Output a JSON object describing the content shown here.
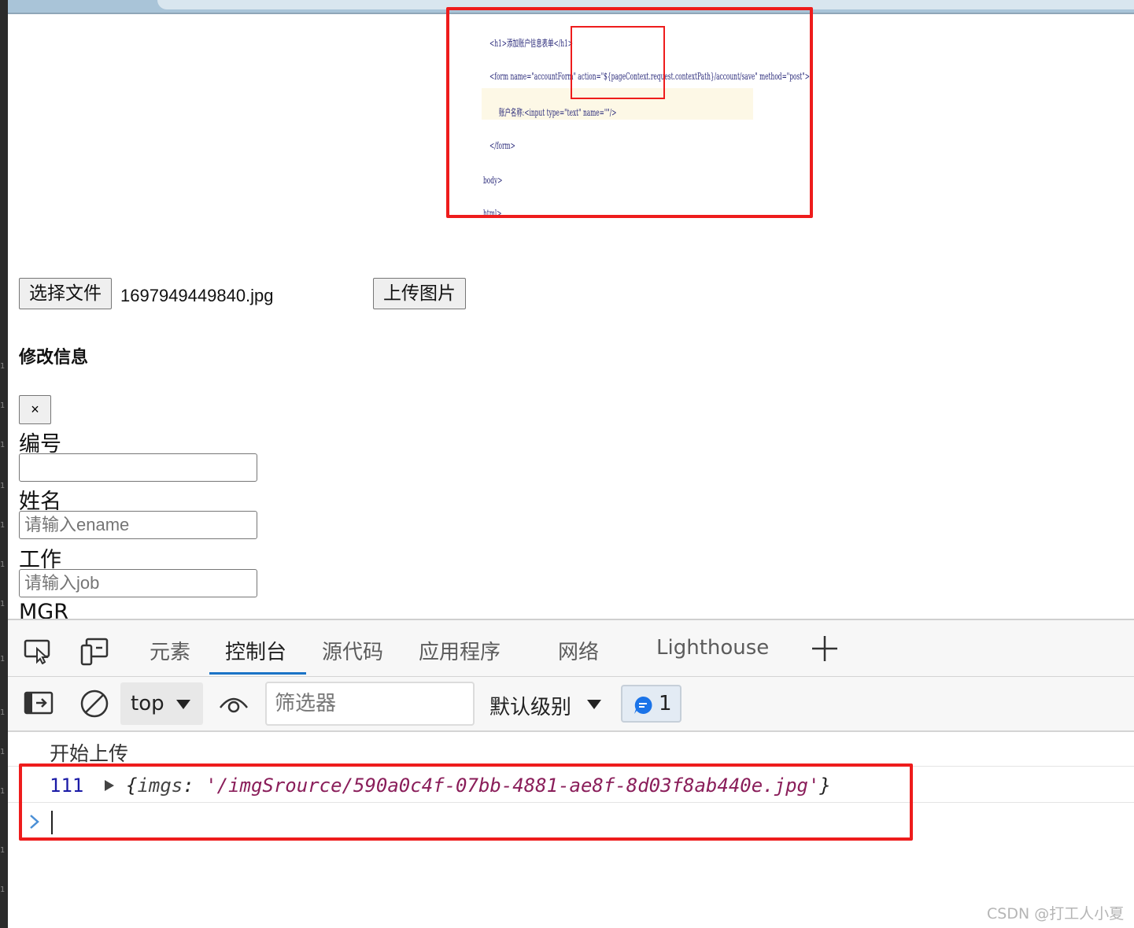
{
  "preview": {
    "lines": [
      "<h1>添加账户信息表单</h1>",
      "<form name=\"accountForm\" action=\"${pageContext.request.contextPath}/account/save\" method=\"post\">",
      "账户名称:<input type=\"text\" name=\"\"/>",
      "</form>",
      "body>",
      "html>"
    ]
  },
  "upload": {
    "choose_label": "选择文件",
    "file_name": "1697949449840.jpg",
    "upload_label": "上传图片"
  },
  "form": {
    "heading": "修改信息",
    "close_label": "×",
    "fields": [
      {
        "label": "编号",
        "value": "",
        "placeholder": ""
      },
      {
        "label": "姓名",
        "value": "",
        "placeholder": "请输入ename"
      },
      {
        "label": "工作",
        "value": "",
        "placeholder": "请输入job"
      },
      {
        "label": "MGR"
      }
    ]
  },
  "devtools": {
    "tabs": [
      "元素",
      "控制台",
      "源代码",
      "应用程序",
      "网络",
      "Lighthouse"
    ],
    "active_tab": "控制台",
    "context": "top",
    "filter_placeholder": "筛选器",
    "level": "默认级别",
    "message_count": "1",
    "console": {
      "line1": "开始上传",
      "line2_source": "111",
      "line2_key": "imgs",
      "line2_value": "'/imgSrource/590a0c4f-07bb-4881-ae8f-8d03f8ab440e.jpg'"
    }
  },
  "watermark": "CSDN @打工人小夏",
  "colors": {
    "accent": "#1a73c6",
    "highlight_red": "#ee1c1c"
  }
}
